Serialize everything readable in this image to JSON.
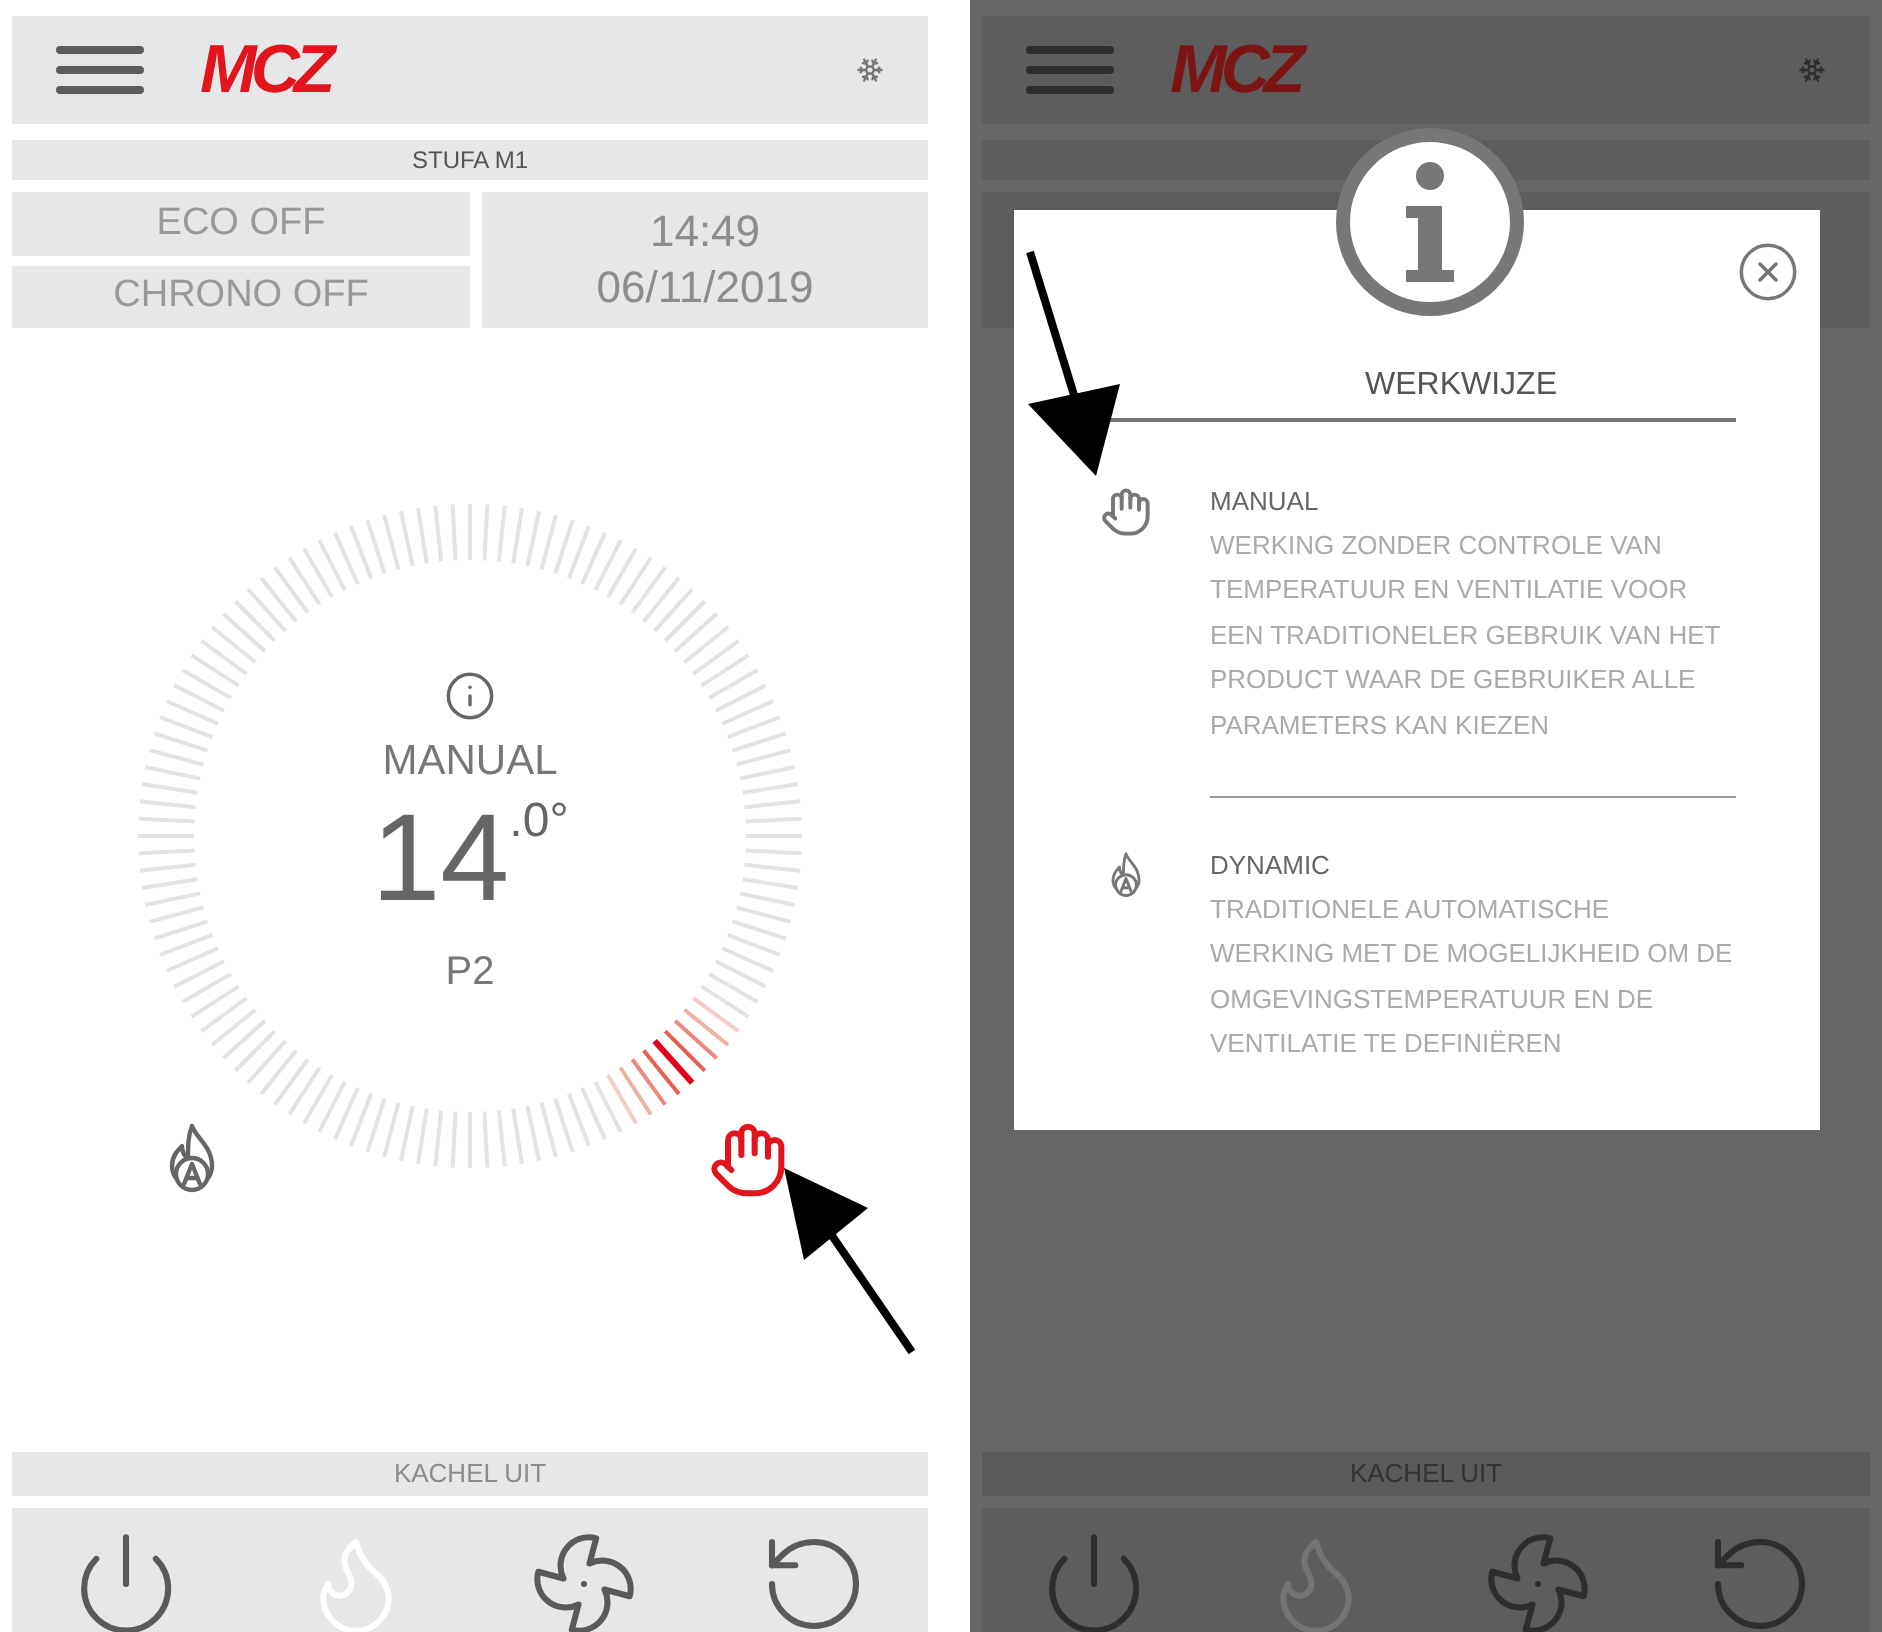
{
  "left_screen": {
    "header": {
      "logo": "MCZ"
    },
    "stove_name": "STUFA M1",
    "eco": "ECO OFF",
    "chrono": "CHRONO OFF",
    "time": "14:49",
    "date": "06/11/2019",
    "dial": {
      "mode": "MANUAL",
      "temperature_whole": "14",
      "temperature_decimal": ".0°",
      "power": "P2"
    },
    "modes": [
      {
        "kind": "dynamic",
        "selected": false
      },
      {
        "kind": "manual",
        "selected": true
      }
    ],
    "status": "KACHEL UIT",
    "controls": [
      {
        "kind": "power",
        "disabled": false
      },
      {
        "kind": "flame",
        "disabled": true
      },
      {
        "kind": "fan",
        "disabled": false
      },
      {
        "kind": "reset",
        "disabled": false
      }
    ]
  },
  "right_screen": {
    "header": {
      "logo": "MCZ"
    },
    "status": "KACHEL UIT",
    "controls": [
      {
        "kind": "power",
        "disabled": false
      },
      {
        "kind": "flame",
        "disabled": true
      },
      {
        "kind": "fan",
        "disabled": false
      },
      {
        "kind": "reset",
        "disabled": false
      }
    ],
    "info_dialog": {
      "title": "WERKWIJZE",
      "entries": [
        {
          "kind": "manual",
          "name": "MANUAL",
          "description": "WERKING ZONDER CONTROLE VAN TEMPERATUUR EN VENTILATIE VOOR EEN TRADITIONELER GEBRUIK VAN HET PRODUCT WAAR DE GEBRUIKER ALLE PARAMETERS KAN KIEZEN"
        },
        {
          "kind": "dynamic",
          "name": "DYNAMIC",
          "description": "TRADITIONELE AUTOMATISCHE WERKING MET DE MOGELIJKHEID OM DE OMGEVINGSTEMPERATUUR EN DE VENTILATIE TE DEFINIËREN"
        }
      ]
    }
  }
}
